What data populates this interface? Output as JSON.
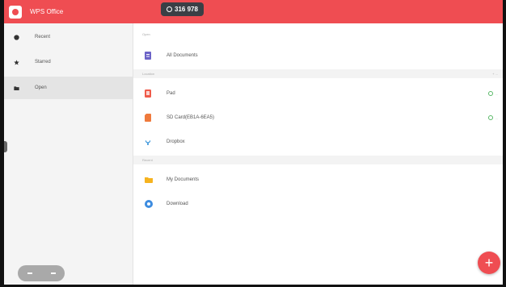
{
  "app": {
    "title": "WPS Office"
  },
  "status": {
    "counter_text": "316 978"
  },
  "sidebar": {
    "items": [
      {
        "label": "Recent",
        "icon": "clock-icon"
      },
      {
        "label": "Starred",
        "icon": "star-icon"
      },
      {
        "label": "Open",
        "icon": "folder-icon",
        "active": true
      }
    ]
  },
  "main": {
    "sections": [
      {
        "title": "Open"
      },
      {
        "title": "Location",
        "right_text": "+ ..."
      },
      {
        "title": "Recent"
      }
    ],
    "rows": [
      {
        "label": "All Documents",
        "icon": "documents-icon"
      },
      {
        "label": "Pad",
        "icon": "tablet-icon",
        "status": "..."
      },
      {
        "label": "SD Card(EB1A-6EA5)",
        "icon": "sd-card-icon",
        "status": "..."
      },
      {
        "label": "Dropbox",
        "icon": "dropbox-icon"
      },
      {
        "label": "My Documents",
        "icon": "folder-icon"
      },
      {
        "label": "Download",
        "icon": "download-icon"
      }
    ]
  },
  "fab": {
    "label": "+"
  },
  "colors": {
    "accent": "#ef4d52",
    "status_green": "#58b866"
  }
}
